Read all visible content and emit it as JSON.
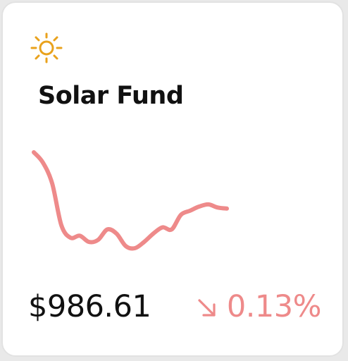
{
  "fund": {
    "name": "Solar Fund",
    "price": "$986.61",
    "change": "0.13%",
    "direction": "down"
  },
  "icons": {
    "fund_icon": "sun-icon",
    "change_icon": "arrow-down-right-icon"
  },
  "colors": {
    "sun": "#e9a21c",
    "negative": "#ee8a8a",
    "text": "#111111"
  },
  "sparkline": {
    "values": [
      100,
      90,
      70,
      30,
      18,
      20,
      14,
      16,
      26,
      22,
      10,
      8,
      14,
      22,
      28,
      26,
      40,
      44,
      48,
      50,
      47,
      46
    ]
  }
}
